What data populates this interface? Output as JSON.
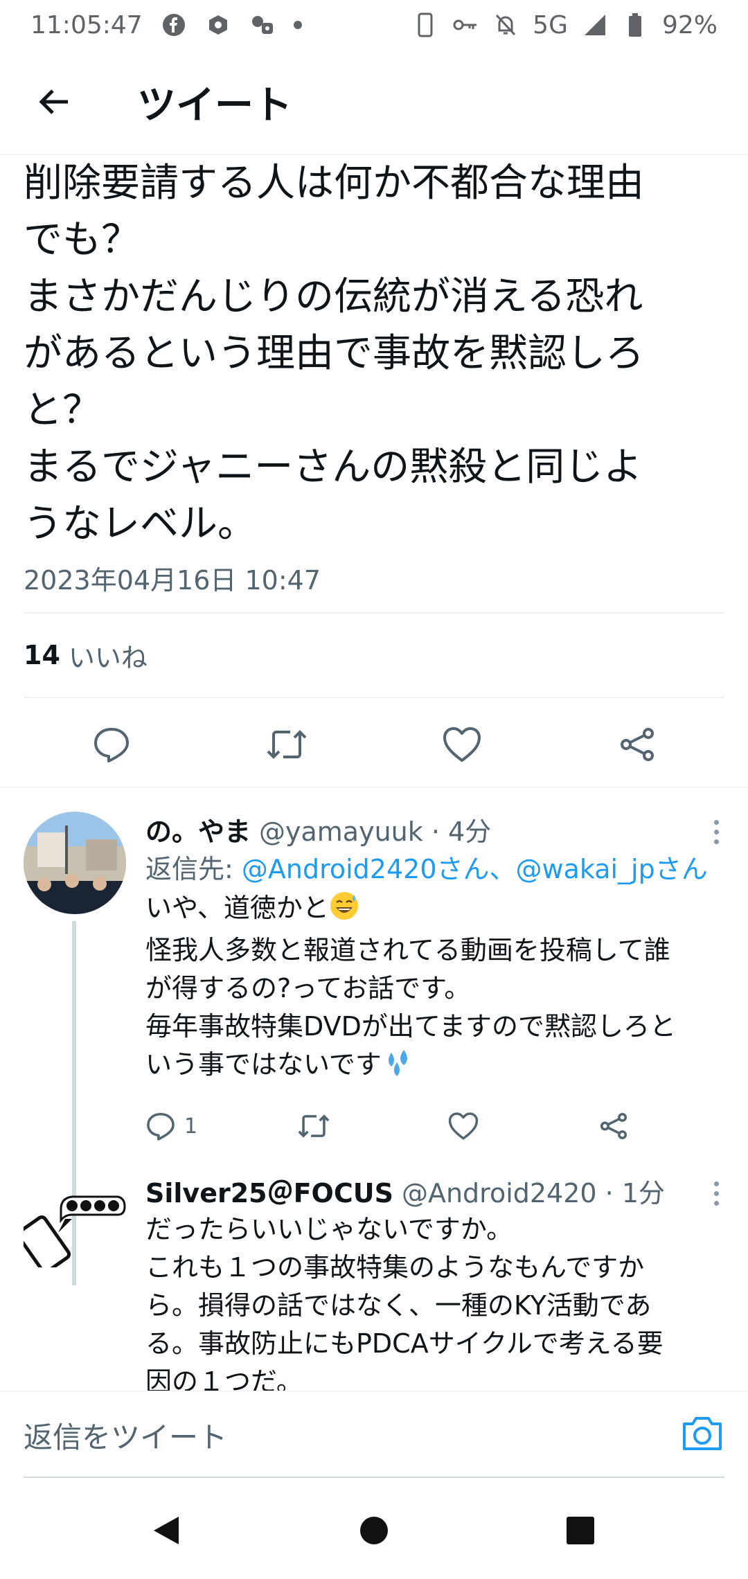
{
  "status_bar": {
    "time": "11:05:47",
    "network": "5G",
    "battery": "92%"
  },
  "header": {
    "title": "ツイート"
  },
  "main_tweet": {
    "text": "削除要請する人は何か不都合な理由\nでも？\nまさかだんじりの伝統が消える恐れ\nがあるという理由で事故を黙認しろ\nと？\nまるでジャニーさんの黙殺と同じよ\nうなレベル。",
    "timestamp": "2023年04月16日 10:47",
    "like_count": "14",
    "like_label": "いいね"
  },
  "replies": [
    {
      "name": "の。やま",
      "handle": "@yamayuuk · 4分",
      "reply_to_label": "返信先: ",
      "reply_to_mentions": "@Android2420さん、@wakai_jpさん",
      "text_line1": "いや、道徳かと",
      "text_middle": "怪我人多数と報道されてる動画を投稿して誰\nが得するの?ってお話です。\n毎年事故特集DVDが出てますので黙認しろと\nいう事ではないです",
      "reply_count": "1"
    },
    {
      "name": "Silver25＠FOCUS",
      "handle": "@Android2420 · 1分",
      "text": "だったらいいじゃないですか。\nこれも１つの事故特集のようなもんですか\nら。損得の話ではなく、一種のKY活動であ\nる。事故防止にもPDCAサイクルで考える要\n因の１つだ。"
    }
  ],
  "composer": {
    "placeholder": "返信をツイート"
  },
  "colors": {
    "accent": "#1d9bf0",
    "secondary_text": "#536471",
    "divider": "#eff3f4"
  },
  "icons": {
    "back": "arrow-left-icon",
    "reply": "speech-bubble-icon",
    "retweet": "retweet-icon",
    "like": "heart-icon",
    "share": "share-icon",
    "camera": "camera-icon"
  }
}
